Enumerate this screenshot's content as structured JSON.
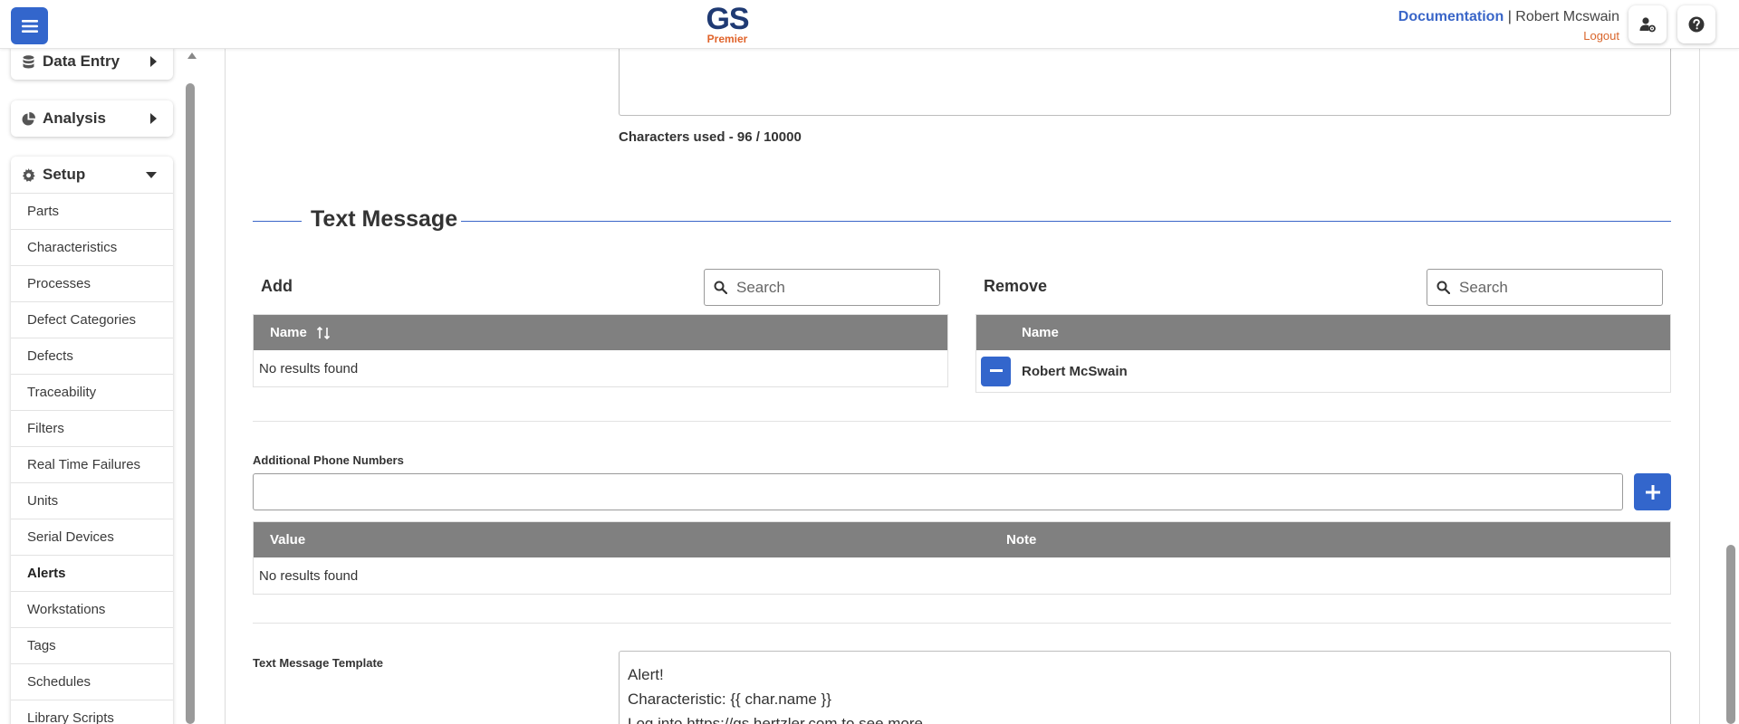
{
  "header": {
    "logo_main": "GS",
    "logo_sub": "Premier",
    "documentation_link": "Documentation",
    "separator": "|",
    "user_name": "Robert Mcswain",
    "logout_link": "Logout",
    "brand_color": "#3366cc"
  },
  "sidebar": {
    "sections": [
      {
        "label": "Data Entry",
        "icon": "database-icon"
      },
      {
        "label": "Analysis",
        "icon": "pie-chart-icon"
      },
      {
        "label": "Setup",
        "icon": "gear-icon"
      }
    ],
    "setup_items": [
      {
        "label": "Parts"
      },
      {
        "label": "Characteristics"
      },
      {
        "label": "Processes"
      },
      {
        "label": "Defect Categories"
      },
      {
        "label": "Defects"
      },
      {
        "label": "Traceability"
      },
      {
        "label": "Filters"
      },
      {
        "label": "Real Time Failures"
      },
      {
        "label": "Units"
      },
      {
        "label": "Serial Devices"
      },
      {
        "label": "Alerts",
        "active": true
      },
      {
        "label": "Workstations"
      },
      {
        "label": "Tags"
      },
      {
        "label": "Schedules"
      },
      {
        "label": "Library Scripts"
      }
    ]
  },
  "email": {
    "characters_used": "Characters used - 96 / 10000"
  },
  "text_message": {
    "title": "Text Message",
    "add": {
      "label": "Add",
      "search_placeholder": "Search",
      "column_name": "Name",
      "empty_text": "No results found"
    },
    "remove": {
      "label": "Remove",
      "search_placeholder": "Search",
      "column_name": "Name",
      "rows": [
        {
          "name": "Robert McSwain"
        }
      ]
    },
    "additional_phone": {
      "label": "Additional Phone Numbers",
      "value": "",
      "columns": [
        "Value",
        "Note"
      ],
      "empty_text": "No results found"
    },
    "template": {
      "label": "Text Message Template",
      "lines": [
        "Alert!",
        "Characteristic: {{ char.name }}",
        "Log into https://gs.hertzler.com to see more"
      ]
    }
  }
}
